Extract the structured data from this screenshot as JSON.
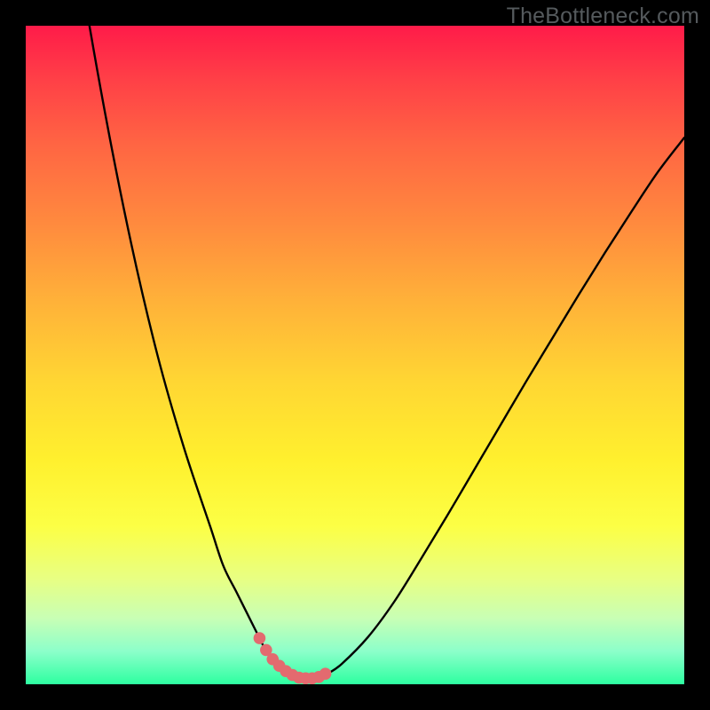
{
  "watermark": {
    "text": "TheBottleneck.com"
  },
  "colors": {
    "background": "#000000",
    "curve_stroke": "#000000",
    "marker_fill": "#e36a6f",
    "gradient_top": "#ff1b49",
    "gradient_bottom": "#2dffa0"
  },
  "chart_data": {
    "type": "line",
    "title": "",
    "xlabel": "",
    "ylabel": "",
    "xlim": [
      0,
      100
    ],
    "ylim": [
      0,
      100
    ],
    "grid": false,
    "legend": null,
    "x": [
      0,
      4,
      8,
      12,
      16,
      20,
      24,
      28,
      30,
      32,
      34,
      35,
      36,
      37,
      38,
      39,
      40,
      41,
      42,
      43,
      44,
      45,
      46,
      48,
      52,
      56,
      60,
      64,
      68,
      72,
      76,
      80,
      84,
      88,
      92,
      96,
      100
    ],
    "series": [
      {
        "name": "curve",
        "values": [
          165,
          136,
          110,
          87,
          67,
          50,
          36,
          24,
          18,
          14,
          10,
          8,
          6,
          4.5,
          3.2,
          2.3,
          1.6,
          1.1,
          0.9,
          0.8,
          0.9,
          1.2,
          1.7,
          3.1,
          7.2,
          12.6,
          19.0,
          25.6,
          32.4,
          39.2,
          46.0,
          52.6,
          59.2,
          65.6,
          71.8,
          77.8,
          83.0
        ]
      }
    ],
    "markers": {
      "x": [
        35.5,
        36.5,
        37.5,
        38.5,
        39.5,
        40.5,
        41.5,
        42.5,
        43.5,
        44.5,
        45.5
      ],
      "y": [
        7.0,
        5.2,
        3.8,
        2.8,
        2.0,
        1.4,
        1.0,
        0.9,
        0.9,
        1.1,
        1.6
      ]
    },
    "note": "Bottleneck-style V-curve over rainbow heat gradient; y values are percent above baseline (clipped/plotted out of frame at top-left). Axis numerals are not rendered in the image; values are read off by proportional position."
  }
}
